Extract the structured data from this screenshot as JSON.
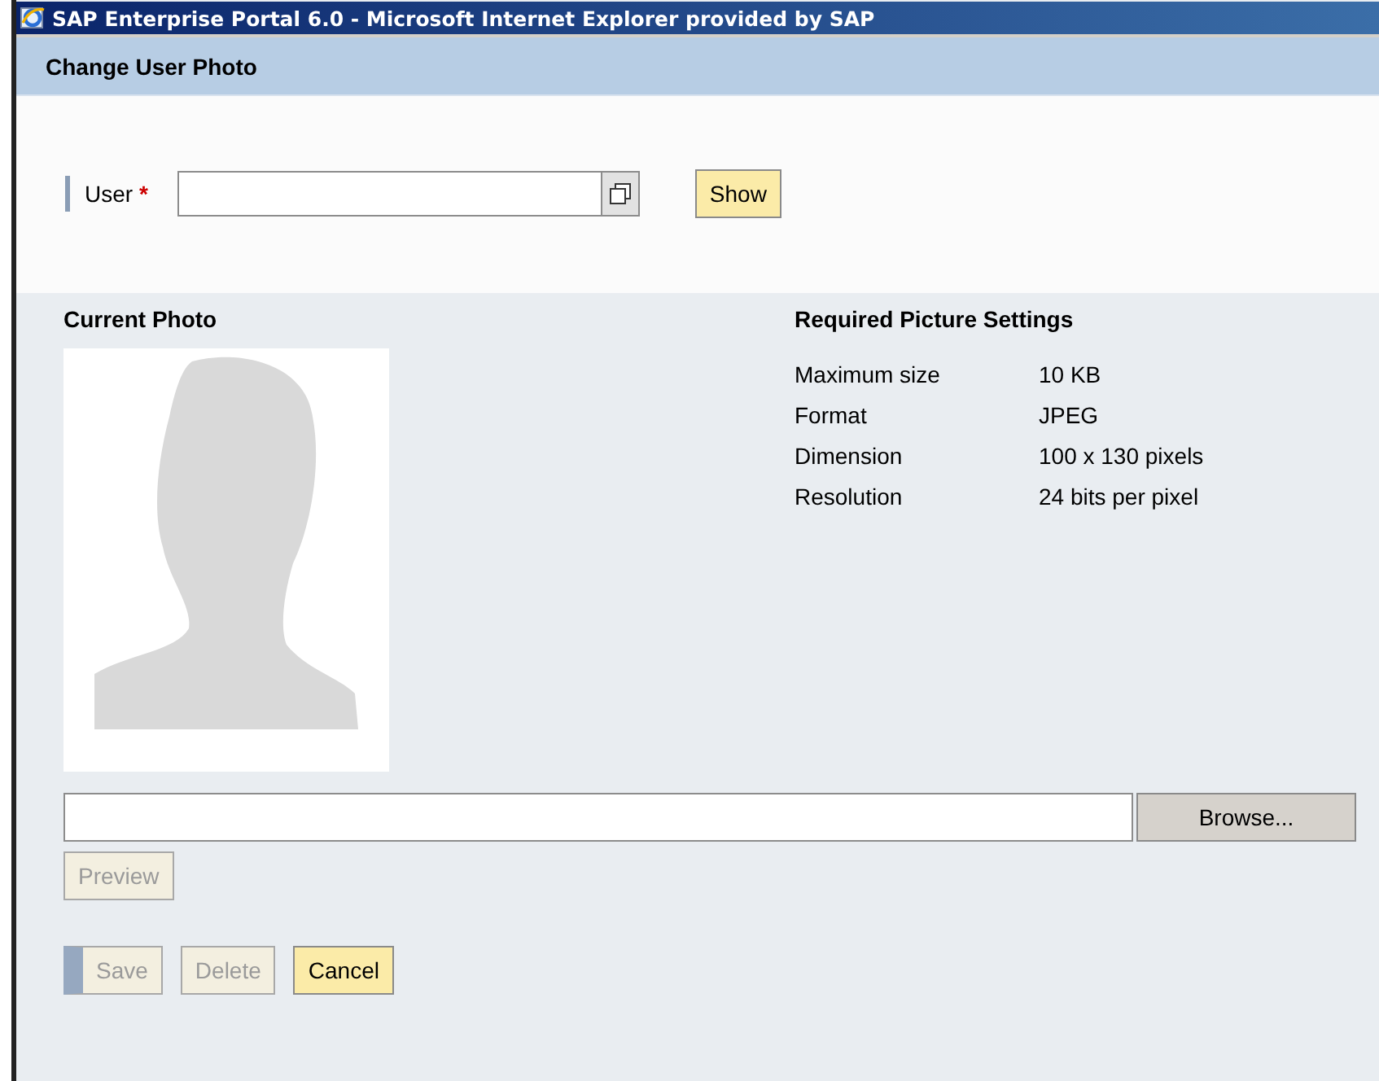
{
  "window": {
    "title": "SAP Enterprise Portal 6.0 - Microsoft Internet Explorer provided by SAP"
  },
  "page": {
    "title": "Change User Photo"
  },
  "user_field": {
    "label": "User",
    "required": true,
    "required_mark": "*"
  },
  "show_button": {
    "label": "Show",
    "disabled": false
  },
  "current_photo": {
    "heading": "Current Photo"
  },
  "settings": {
    "heading": "Required Picture Settings",
    "rows": [
      {
        "label": "Maximum size",
        "value": "10 KB"
      },
      {
        "label": "Format",
        "value": "JPEG"
      },
      {
        "label": "Dimension",
        "value": "100 x 130 pixels"
      },
      {
        "label": "Resolution",
        "value": "24 bits per pixel"
      }
    ]
  },
  "upload": {
    "browse_label": "Browse..."
  },
  "preview_button": {
    "label": "Preview",
    "disabled": true
  },
  "buttons": [
    {
      "label": "Save",
      "disabled": true,
      "emphasized": true
    },
    {
      "label": "Delete",
      "disabled": true,
      "emphasized": false
    },
    {
      "label": "Cancel",
      "disabled": false,
      "emphasized": false
    }
  ]
}
